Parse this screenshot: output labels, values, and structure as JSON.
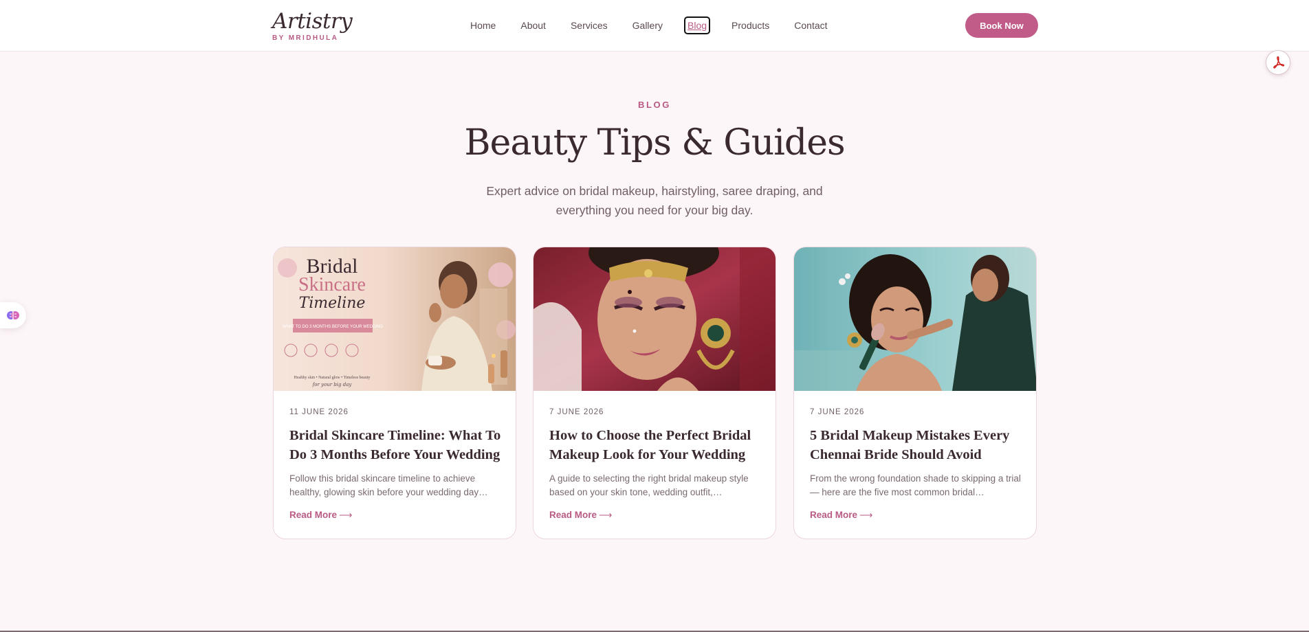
{
  "brand": {
    "name": "Artistry",
    "tagline": "BY MRIDHULA"
  },
  "nav": {
    "items": [
      {
        "label": "Home"
      },
      {
        "label": "About"
      },
      {
        "label": "Services"
      },
      {
        "label": "Gallery"
      },
      {
        "label": "Blog",
        "active": true
      },
      {
        "label": "Products"
      },
      {
        "label": "Contact"
      }
    ],
    "cta_label": "Book Now"
  },
  "icons": {
    "pdf": "pdf-icon",
    "assistant": "brain-icon",
    "arrow": "arrow-right-icon"
  },
  "colors": {
    "accent": "#c05c87",
    "text": "#3a2a30",
    "background": "#fdf6f8"
  },
  "hero": {
    "eyebrow": "BLOG",
    "title": "Beauty Tips & Guides",
    "subtitle": "Expert advice on bridal makeup, hairstyling, saree draping, and everything you need for your big day."
  },
  "posts": [
    {
      "date": "11 JUNE 2026",
      "title": "Bridal Skincare Timeline: What To Do 3 Months Before Your Wedding",
      "excerpt": "Follow this bridal skincare timeline to achieve healthy, glowing skin before your wedding day…",
      "cta": "Read More",
      "image_text": {
        "line1": "Bridal",
        "line2": "Skincare",
        "line3": "Timeline",
        "banner": "WHAT TO DO 3 MONTHS BEFORE YOUR WEDDING",
        "footer": "Healthy skin • Natural glow • Timeless beauty",
        "script": "for your big day"
      }
    },
    {
      "date": "7 JUNE 2026",
      "title": "How to Choose the Perfect Bridal Makeup Look for Your Wedding",
      "excerpt": "A guide to selecting the right bridal makeup style based on your skin tone, wedding outfit,…",
      "cta": "Read More"
    },
    {
      "date": "7 JUNE 2026",
      "title": "5 Bridal Makeup Mistakes Every Chennai Bride Should Avoid",
      "excerpt": "From the wrong foundation shade to skipping a trial — here are the five most common bridal…",
      "cta": "Read More"
    }
  ]
}
